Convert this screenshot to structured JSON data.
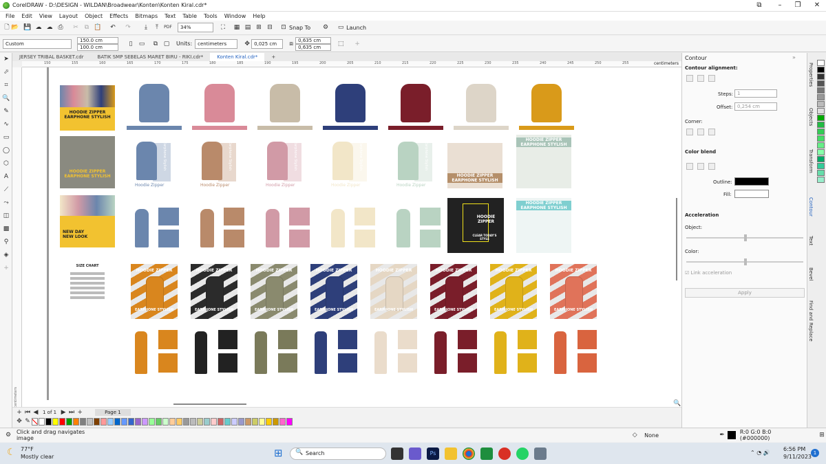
{
  "window": {
    "title": "CorelDRAW - D:\\DESIGN - WILDAN\\Broadwear\\Konten\\Konten Kiral.cdr*"
  },
  "menu": [
    "File",
    "Edit",
    "View",
    "Layout",
    "Object",
    "Effects",
    "Bitmaps",
    "Text",
    "Table",
    "Tools",
    "Window",
    "Help"
  ],
  "toolbar1": {
    "zoom": "34%",
    "snap": "Snap To",
    "launch": "Launch",
    "pdf": "PDF"
  },
  "toolbar2": {
    "preset": "Custom",
    "width": "150.0 cm",
    "height": "100.0 cm",
    "units_label": "Units:",
    "units": "centimeters",
    "nudge": "0,025 cm",
    "dup_x": "0,635 cm",
    "dup_y": "0,635 cm"
  },
  "tabs": [
    "JERSEY TRIBAL BASKET.cdr",
    "BATIK SMP SEBELAS MARET BIRU - RIKI.cdr*",
    "Konten Kiral.cdr*"
  ],
  "ruler": {
    "ticks": [
      "150",
      "155",
      "160",
      "165",
      "170",
      "175",
      "180",
      "185",
      "190",
      "195",
      "200",
      "205",
      "210",
      "215",
      "220",
      "225",
      "230",
      "235",
      "240",
      "245",
      "250",
      "255"
    ],
    "unit": "centimeters"
  },
  "ruler_v_unit": "centimeters",
  "canvas": {
    "hoodie_colors": [
      "#6b86ad",
      "#d98a98",
      "#c8bca8",
      "#2e3f7a",
      "#7a1e2a",
      "#ddd5c8",
      "#d99a1a"
    ],
    "banner_text_1": "HOODIE ZIPPER\nEARPHONE STYLISH",
    "banner_text_2": "HOODIE ZIPPER\nEARPHONE STYLISH",
    "row2_colors": [
      "#6b86ad",
      "#b98a6a",
      "#d19aa6",
      "#f2e6c8",
      "#b9d3c2"
    ],
    "row2_label": "Hoodie Zipper",
    "row2_side": "Earphone Stylish",
    "row2_banner_a": "HOODIE ZIPPER\nEARPHONE STYLISH",
    "row2_banner_b": "HOODIE ZIPPER\nEARPHONE STYLISH",
    "row3_banner": "NEW DAY\nNEW LOOK",
    "row3_colors": [
      "#6b86ad",
      "#b98a6a",
      "#d19aa6",
      "#f2e6c8",
      "#b9d3c2"
    ],
    "row3_dark": "HOODIE ZIPPER",
    "row3_dark_sub": "CLEAR TODAY'S\nSTYLE",
    "row3_teal": "HOODIE ZIPPER\nEARPHONE STYLISH",
    "size_chart": "SIZE CHART",
    "poster_colors": [
      "#d9861e",
      "#2b2b2b",
      "#8a8a6e",
      "#2e3f7a",
      "#e5d7c4",
      "#7a1e2a",
      "#e0b21a",
      "#e0735a"
    ],
    "poster_title": "HOODIE ZIPPER",
    "poster_sub": "EARPHONE STYLISH",
    "row5_colors": [
      "#d9861e",
      "#222222",
      "#7a7a5a",
      "#2e3f7a",
      "#eadccb",
      "#7a1e2a",
      "#e0b21a",
      "#d9643f"
    ]
  },
  "pagebar": {
    "count": "1 of 1",
    "page": "Page 1"
  },
  "palette": [
    "#ffffff",
    "#000000",
    "#ffff00",
    "#ff0000",
    "#00a000",
    "#ff8000",
    "#808080",
    "#c0c0c0",
    "#804000",
    "#ff9999",
    "#99ccff",
    "#0066cc",
    "#6699ff",
    "#3366cc",
    "#9966cc",
    "#cc99ff",
    "#99ff99",
    "#66cc66",
    "#ccffcc",
    "#ffcc99",
    "#ffcc66",
    "#999999",
    "#bbbbbb",
    "#cccc99",
    "#99cccc",
    "#ffcccc",
    "#cc6666",
    "#66cccc",
    "#ccccff",
    "#9999cc",
    "#cc9966",
    "#cccc66",
    "#ffff99",
    "#ffcc00",
    "#cc9900",
    "#ff66cc",
    "#ff00ff"
  ],
  "vpalette": [
    "#ffffff",
    "#000000",
    "#333333",
    "#555555",
    "#777777",
    "#999999",
    "#bbbbbb",
    "#dddddd",
    "#00aa00",
    "#22bb44",
    "#33cc55",
    "#44dd66",
    "#66ee88",
    "#88ffaa",
    "#00aa66",
    "#33cc99",
    "#66ddaa",
    "#99eecc"
  ],
  "docker": {
    "title": "Contour",
    "alignment": "Contour alignment:",
    "steps_label": "Steps:",
    "steps": "1",
    "offset_label": "Offset:",
    "offset": "0,254 cm",
    "corner": "Corner:",
    "color_blend": "Color blend",
    "outline": "Outline:",
    "fill": "Fill:",
    "acceleration": "Acceleration",
    "object": "Object:",
    "color": "Color:",
    "link": "Link acceleration",
    "apply": "Apply"
  },
  "docker_tabs": [
    "Properties",
    "Objects",
    "Transform",
    "Contour",
    "Text",
    "Bevel",
    "Find and Replace"
  ],
  "status": {
    "hint": "Click and drag navigates image",
    "fill": "None",
    "color": "R:0 G:0 B:0 (#000000)"
  },
  "taskbar": {
    "temp": "77°F",
    "weather": "Mostly clear",
    "search": "Search",
    "time": "6:56 PM",
    "date": "9/11/2023",
    "notif": "1"
  }
}
